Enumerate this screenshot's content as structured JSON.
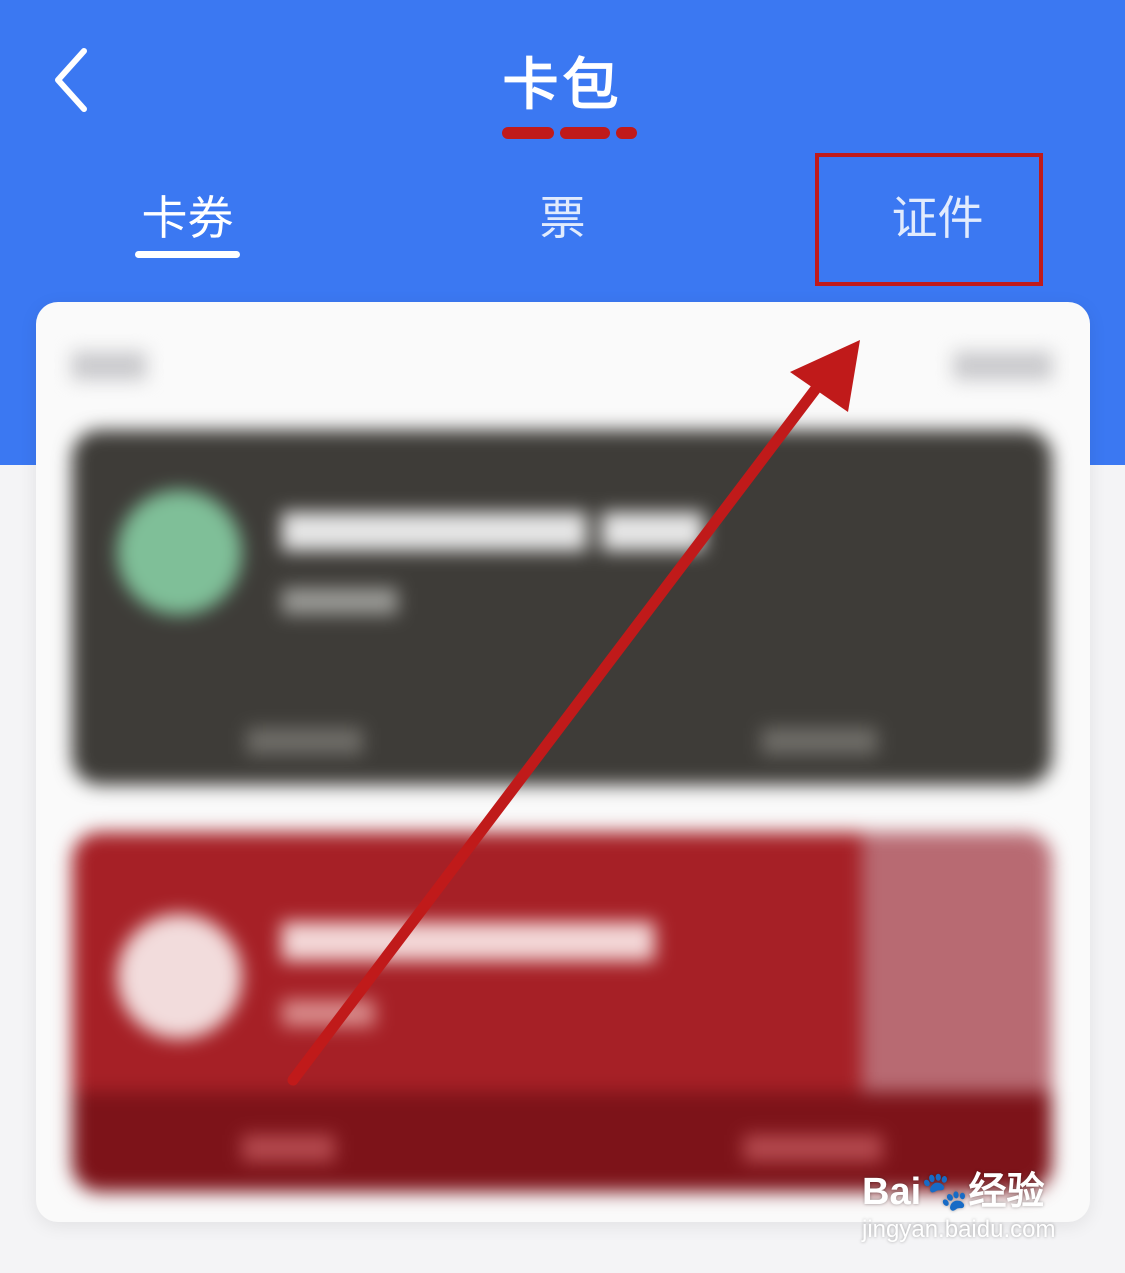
{
  "header": {
    "title": "卡包",
    "back_icon": "chevron-left-icon",
    "color": "#3b78f2"
  },
  "tabs": [
    {
      "label": "卡券",
      "active": true
    },
    {
      "label": "票",
      "active": false
    },
    {
      "label": "证件",
      "active": false
    }
  ],
  "annotation": {
    "highlight_color": "#c01a1a",
    "arrow_color": "#c01a1a"
  },
  "watermark": {
    "brand": "Bai🐾经验",
    "url": "jingyan.baidu.com"
  }
}
